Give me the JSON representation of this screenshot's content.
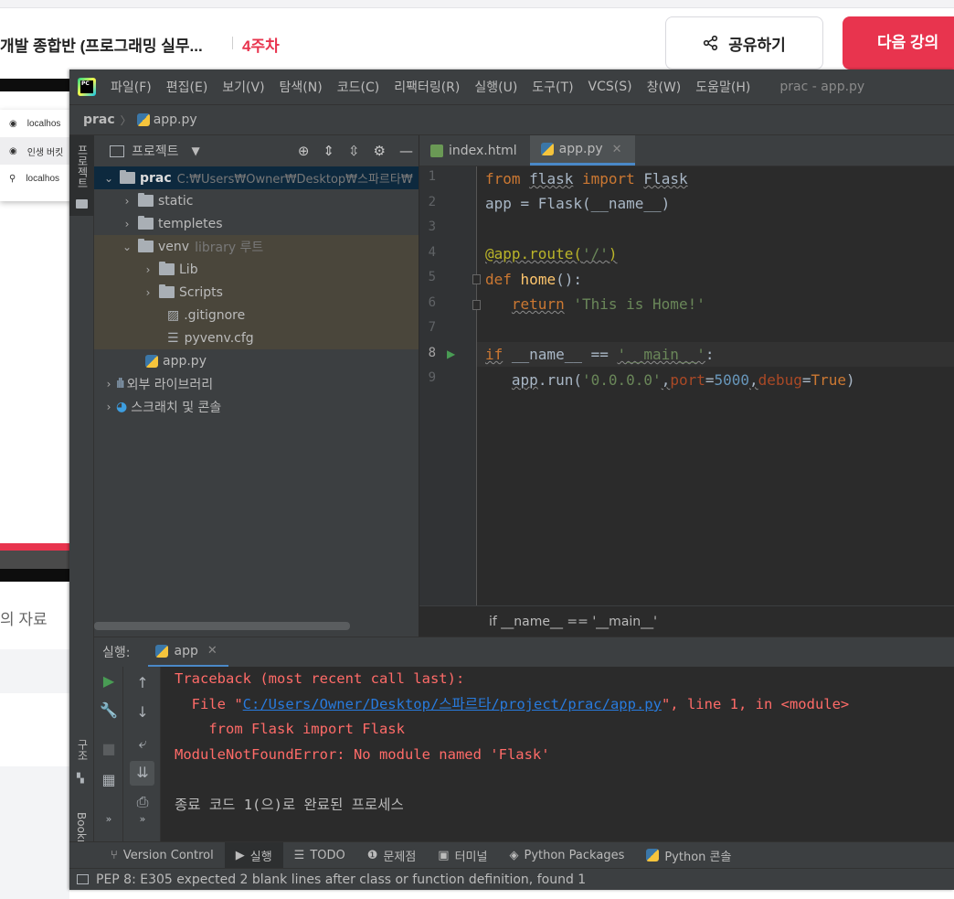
{
  "browser": {
    "course_title": "개발 종합반 (프로그래밍 실무...",
    "course_week": "4주차",
    "share_label": "공유하기",
    "next_label": "다음 강의",
    "history_items": [
      "localhos",
      "인생 버킷",
      "localhos"
    ],
    "materials_text": "의 자료"
  },
  "ide": {
    "logo": "PC",
    "menu": [
      "파일(F)",
      "편집(E)",
      "보기(V)",
      "탐색(N)",
      "코드(C)",
      "리팩터링(R)",
      "실행(U)",
      "도구(T)",
      "VCS(S)",
      "창(W)",
      "도움말(H)"
    ],
    "window_title": "prac - app.py",
    "breadcrumb": {
      "project": "prac",
      "file": "app.py"
    },
    "left_strip": {
      "project_tab": "프로젝트",
      "structure_tab": "구조",
      "bookmarks_tab": "Bookmarks"
    },
    "project_panel": {
      "title": "프로젝트",
      "tree": {
        "root_name": "prac",
        "root_path": "C:₩Users₩Owner₩Desktop₩스파르타₩",
        "static": "static",
        "templetes": "templetes",
        "venv": "venv",
        "venv_note": "library 루트",
        "lib": "Lib",
        "scripts": "Scripts",
        "gitignore": ".gitignore",
        "pyvenv": "pyvenv.cfg",
        "app_py": "app.py",
        "external_libs": "외부 라이브러리",
        "scratches": "스크래치 및 콘솔"
      }
    },
    "editor": {
      "tabs": [
        "index.html",
        "app.py"
      ],
      "line_numbers": [
        "1",
        "2",
        "3",
        "4",
        "5",
        "6",
        "7",
        "8",
        "9"
      ],
      "crumb": "if __name__ == '__main__'"
    },
    "run": {
      "label": "실행:",
      "tab": "app",
      "console": {
        "traceback": "Traceback (most recent call last):",
        "file_prefix": "  File \"",
        "file_link": "C:/Users/Owner/Desktop/스파르타/project/prac/app.py",
        "file_suffix": "\", line 1, in <module>",
        "code": "    from Flask import Flask",
        "error": "ModuleNotFoundError: No module named 'Flask'",
        "exit": "종료 코드 1(으)로 완료된 프로세스"
      }
    },
    "bottom_tools": [
      "Version Control",
      "실행",
      "TODO",
      "문제점",
      "터미널",
      "Python Packages",
      "Python 콘솔"
    ],
    "status": "PEP 8: E305 expected 2 blank lines after class or function definition, found 1"
  },
  "colors": {
    "accent": "#e8344e",
    "ide_bg": "#2b2b2b",
    "ide_panel": "#3c3f41",
    "error": "#ff6b68",
    "link": "#287bde"
  }
}
